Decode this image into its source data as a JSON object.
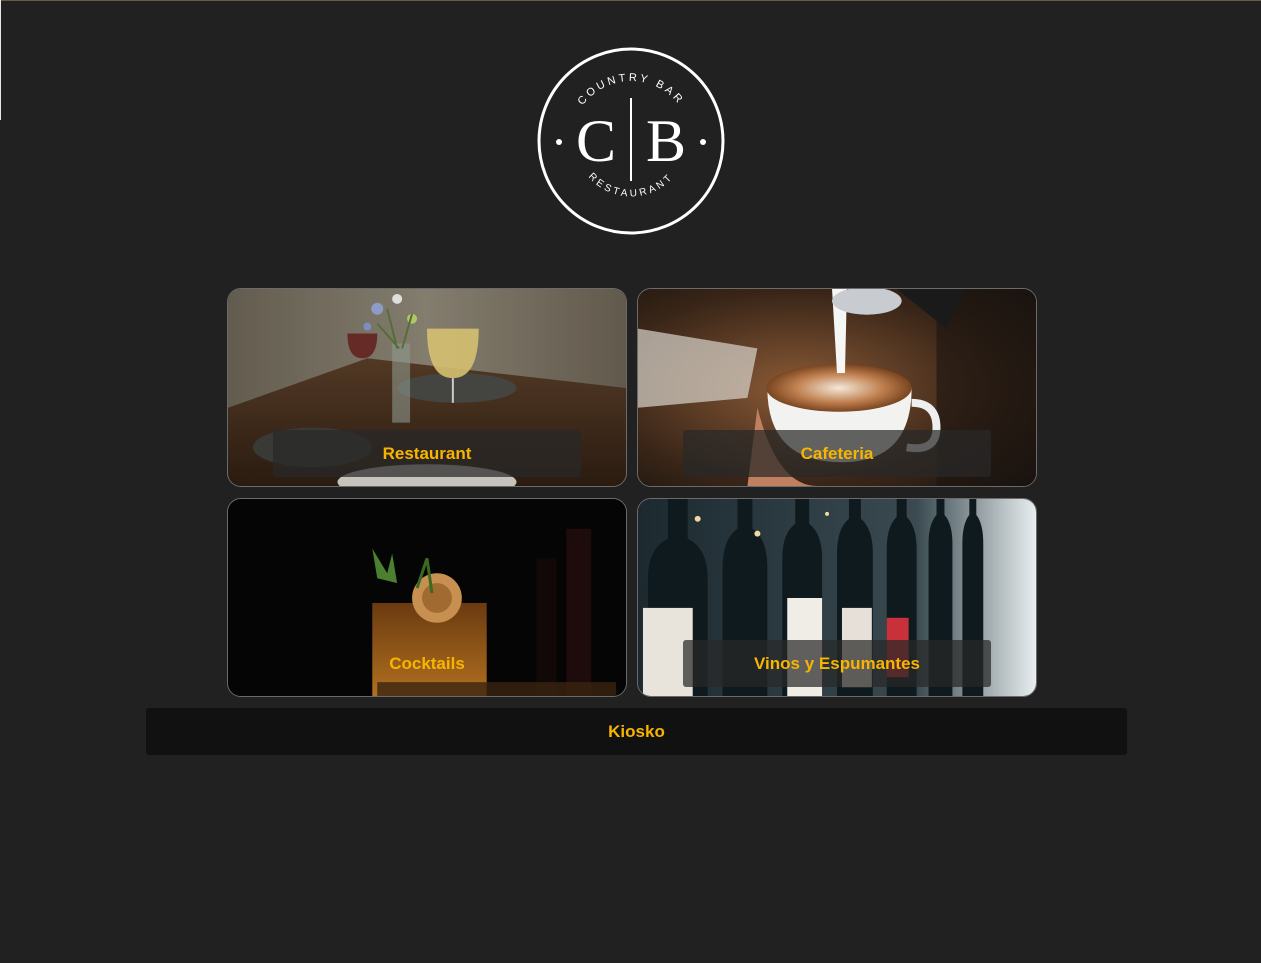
{
  "brand": {
    "logo_top_text": "COUNTRY BAR",
    "logo_left_letter": "C",
    "logo_right_letter": "B",
    "logo_bottom_text": "RESTAURANT"
  },
  "categories": [
    {
      "label": "Restaurant",
      "image": "restaurant-table-photo"
    },
    {
      "label": "Cafeteria",
      "image": "latte-art-photo"
    },
    {
      "label": "Cocktails",
      "image": "cocktail-glass-photo"
    },
    {
      "label": "Vinos y Espumantes",
      "image": "wine-bottles-photo"
    }
  ],
  "kiosko": {
    "label": "Kiosko"
  },
  "colors": {
    "background": "#212121",
    "accent": "#f7b500",
    "button_bg": "#111111"
  }
}
